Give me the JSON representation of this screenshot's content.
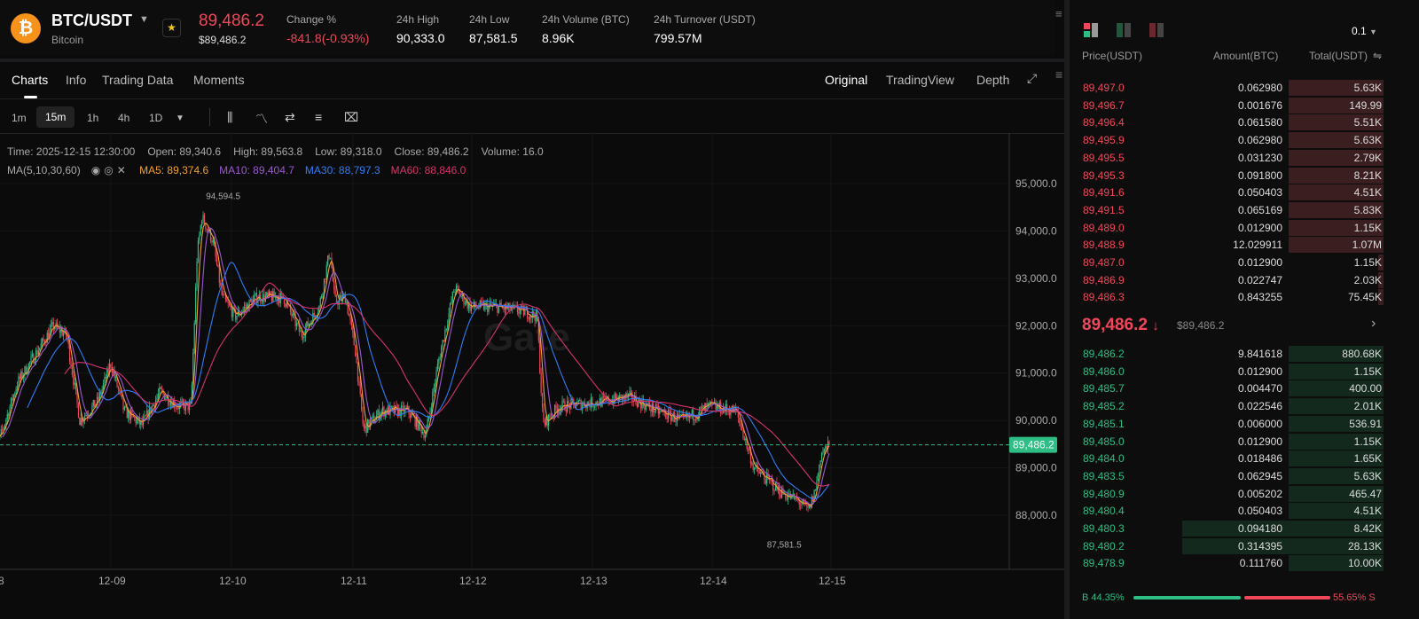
{
  "header": {
    "pair": "BTC/USDT",
    "coin": "Bitcoin",
    "last_price": "89,486.2",
    "last_price_usd": "$89,486.2",
    "stats": [
      {
        "label": "Change %",
        "value": "-841.8(-0.93%)",
        "color": "#f0475a"
      },
      {
        "label": "24h High",
        "value": "90,333.0"
      },
      {
        "label": "24h Low",
        "value": "87,581.5"
      },
      {
        "label": "24h Volume (BTC)",
        "value": "8.96K"
      },
      {
        "label": "24h Turnover (USDT)",
        "value": "799.57M"
      }
    ]
  },
  "tabs": [
    "Charts",
    "Info",
    "Trading Data",
    "Moments"
  ],
  "views": [
    "Original",
    "TradingView",
    "Depth"
  ],
  "timeframes": [
    "1m",
    "15m",
    "1h",
    "4h",
    "1D"
  ],
  "ohlc": {
    "time": "Time: 2025-12-15 12:30:00",
    "open": "Open: 89,340.6",
    "high": "High: 89,563.8",
    "low": "Low: 89,318.0",
    "close": "Close: 89,486.2",
    "volume": "Volume: 16.0"
  },
  "ma": {
    "label": "MA(5,10,30,60)",
    "ma5": "MA5: 89,374.6",
    "ma10": "MA10: 89,404.7",
    "ma30": "MA30: 88,797.3",
    "ma60": "MA60: 88,846.0"
  },
  "colors": {
    "up": "#2ebd85",
    "down": "#f0475a",
    "ma5": "#f0a030",
    "ma10": "#9b59d0",
    "ma30": "#2f7df6",
    "ma60": "#d6336c"
  },
  "chart_data": {
    "type": "candlestick",
    "ylim": [
      87000,
      95700
    ],
    "yticks": [
      "95,000.0",
      "94,000.0",
      "93,000.0",
      "92,000.0",
      "91,000.0",
      "90,000.0",
      "89,000.0",
      "88,000.0"
    ],
    "ytick_values": [
      95000,
      94000,
      93000,
      92000,
      91000,
      90000,
      89000,
      88000
    ],
    "xticks": [
      "8",
      "12-09",
      "12-10",
      "12-11",
      "12-12",
      "12-13",
      "12-14",
      "12-15"
    ],
    "current_price": "89,486.2",
    "current_value": 89486.2,
    "max_label": "94,594.5",
    "max_value": 94594.5,
    "max_t": 1.72,
    "min_label": "87,581.5",
    "min_value": 87581.5,
    "min_t": 6.85,
    "path": [
      [
        0.0,
        89600
      ],
      [
        0.07,
        89600
      ],
      [
        0.22,
        90800
      ],
      [
        0.52,
        92000
      ],
      [
        0.63,
        91800
      ],
      [
        0.74,
        90000
      ],
      [
        0.89,
        90400
      ],
      [
        1.0,
        91200
      ],
      [
        1.11,
        90200
      ],
      [
        1.26,
        89900
      ],
      [
        1.41,
        90600
      ],
      [
        1.56,
        90300
      ],
      [
        1.67,
        90300
      ],
      [
        1.72,
        93500
      ],
      [
        1.76,
        94300
      ],
      [
        1.85,
        93800
      ],
      [
        1.93,
        92600
      ],
      [
        2.04,
        92200
      ],
      [
        2.22,
        92600
      ],
      [
        2.44,
        92600
      ],
      [
        2.59,
        91800
      ],
      [
        2.74,
        92400
      ],
      [
        2.83,
        93600
      ],
      [
        2.87,
        92500
      ],
      [
        2.96,
        92600
      ],
      [
        3.04,
        91500
      ],
      [
        3.11,
        89800
      ],
      [
        3.26,
        90200
      ],
      [
        3.48,
        90200
      ],
      [
        3.63,
        89700
      ],
      [
        3.74,
        91300
      ],
      [
        3.87,
        92800
      ],
      [
        4.0,
        92400
      ],
      [
        4.22,
        92400
      ],
      [
        4.44,
        92300
      ],
      [
        4.56,
        92200
      ],
      [
        4.61,
        89900
      ],
      [
        4.74,
        90300
      ],
      [
        5.11,
        90400
      ],
      [
        5.33,
        90500
      ],
      [
        5.56,
        90200
      ],
      [
        5.78,
        90000
      ],
      [
        6.0,
        90300
      ],
      [
        6.22,
        90200
      ],
      [
        6.37,
        89000
      ],
      [
        6.59,
        88500
      ],
      [
        6.74,
        88300
      ],
      [
        6.83,
        88100
      ],
      [
        6.89,
        88600
      ],
      [
        6.93,
        89300
      ],
      [
        7.01,
        89486
      ]
    ]
  },
  "orderbook": {
    "precision": "0.1",
    "headers": [
      "Price(USDT)",
      "Amount(BTC)",
      "Total(USDT)"
    ],
    "asks": [
      [
        "89,497.0",
        "0.062980",
        "5.63K",
        0.7
      ],
      [
        "89,496.7",
        "0.001676",
        "149.99",
        0.7
      ],
      [
        "89,496.4",
        "0.061580",
        "5.51K",
        0.7
      ],
      [
        "89,495.9",
        "0.062980",
        "5.63K",
        0.7
      ],
      [
        "89,495.5",
        "0.031230",
        "2.79K",
        0.7
      ],
      [
        "89,495.3",
        "0.091800",
        "8.21K",
        0.7
      ],
      [
        "89,491.6",
        "0.050403",
        "4.51K",
        0.7
      ],
      [
        "89,491.5",
        "0.065169",
        "5.83K",
        0.7
      ],
      [
        "89,489.0",
        "0.012900",
        "1.15K",
        0.7
      ],
      [
        "89,488.9",
        "12.029911",
        "1.07M",
        0.7
      ],
      [
        "89,487.0",
        "0.012900",
        "1.15K",
        0.03
      ],
      [
        "89,486.9",
        "0.022747",
        "2.03K",
        0.03
      ],
      [
        "89,486.3",
        "0.843255",
        "75.45K",
        0.03
      ]
    ],
    "mid_price": "89,486.2",
    "mid_usd": "$89,486.2",
    "bids": [
      [
        "89,486.2",
        "9.841618",
        "880.68K",
        0.7
      ],
      [
        "89,486.0",
        "0.012900",
        "1.15K",
        0.7
      ],
      [
        "89,485.7",
        "0.004470",
        "400.00",
        0.7
      ],
      [
        "89,485.2",
        "0.022546",
        "2.01K",
        0.7
      ],
      [
        "89,485.1",
        "0.006000",
        "536.91",
        0.7
      ],
      [
        "89,485.0",
        "0.012900",
        "1.15K",
        0.7
      ],
      [
        "89,484.0",
        "0.018486",
        "1.65K",
        0.7
      ],
      [
        "89,483.5",
        "0.062945",
        "5.63K",
        0.7
      ],
      [
        "89,480.9",
        "0.005202",
        "465.47",
        0.7
      ],
      [
        "89,480.4",
        "0.050403",
        "4.51K",
        0.7
      ],
      [
        "89,480.3",
        "0.094180",
        "8.42K",
        1.0
      ],
      [
        "89,480.2",
        "0.314395",
        "28.13K",
        1.0
      ],
      [
        "89,478.9",
        "0.111760",
        "10.00K",
        0.7
      ]
    ],
    "buy_ratio": "B 44.35%",
    "sell_ratio": "55.65% S",
    "buy_pct": 44.35
  }
}
